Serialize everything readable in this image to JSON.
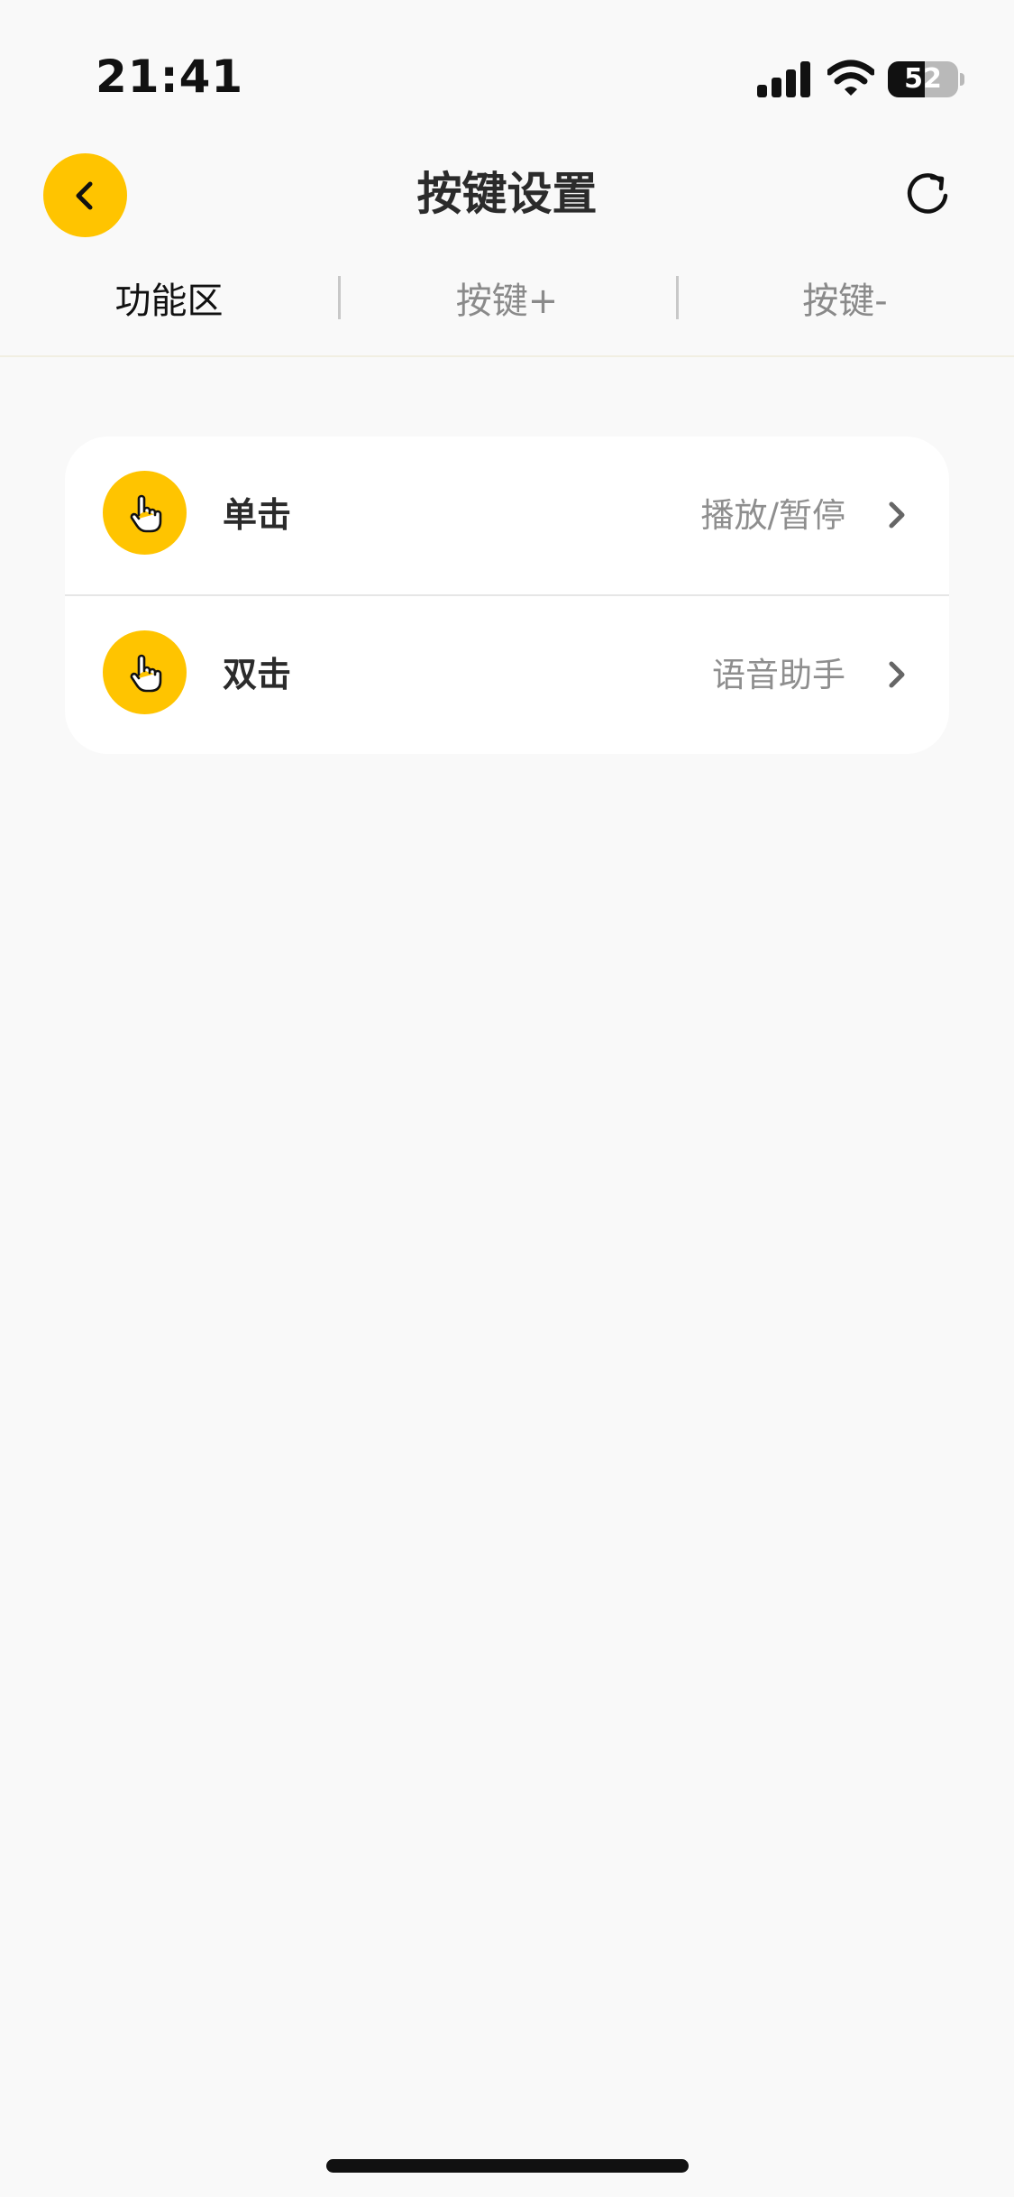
{
  "status_bar": {
    "time": "21:41",
    "battery_level": "52",
    "battery_fraction": 0.52
  },
  "nav": {
    "title": "按键设置",
    "back_icon": "chevron-left-icon",
    "refresh_icon": "refresh-icon"
  },
  "tabs": [
    {
      "label": "功能区",
      "active": true
    },
    {
      "label": "按键+",
      "active": false
    },
    {
      "label": "按键-",
      "active": false
    }
  ],
  "settings": [
    {
      "label": "单击",
      "value": "播放/暂停",
      "icon": "tap-hand-icon"
    },
    {
      "label": "双击",
      "value": "语音助手",
      "icon": "tap-hand-icon"
    }
  ],
  "colors": {
    "accent": "#ffc400",
    "background": "#f9f9f9",
    "card": "#ffffff",
    "secondary_text": "#8e8e8e"
  }
}
